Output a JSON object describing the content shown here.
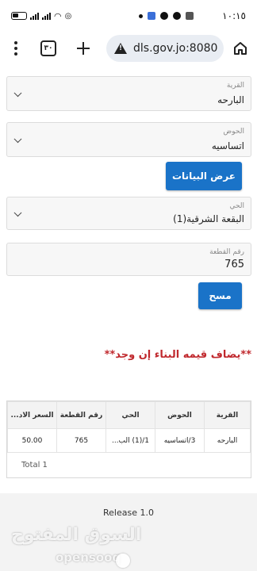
{
  "status_bar": {
    "time": "١٠:١٥"
  },
  "browser": {
    "tab_count": "٣٠",
    "url": "dls.gov.jo:8080"
  },
  "form": {
    "village": {
      "label": "القرية",
      "value": "البارحه"
    },
    "basin": {
      "label": "الحوض",
      "value": "اتساسيه"
    },
    "show_button": "عرض البيانات",
    "neighborhood": {
      "label": "الحي",
      "value": "البقعة الشرقية(1)"
    },
    "parcel": {
      "label": "رقم القطعة",
      "value": "765"
    },
    "clear_button": "مسح"
  },
  "note": "**يضاف قيمه البناء إن وجد**",
  "table": {
    "headers": [
      "القرية",
      "الحوض",
      "الحي",
      "رقم القطعة",
      "السعر الاد..."
    ],
    "rows": [
      [
        "البارحه",
        "3/اتساسيه",
        "1/(1) الب...",
        "765",
        "50.00"
      ]
    ],
    "total": "Total 1"
  },
  "footer": {
    "release": "Release 1.0",
    "watermark_ar": "السوق المفتوح",
    "watermark_en": "opensooq"
  },
  "colors": {
    "primary_button": "#1a73c8",
    "note_red": "#c0282d"
  }
}
